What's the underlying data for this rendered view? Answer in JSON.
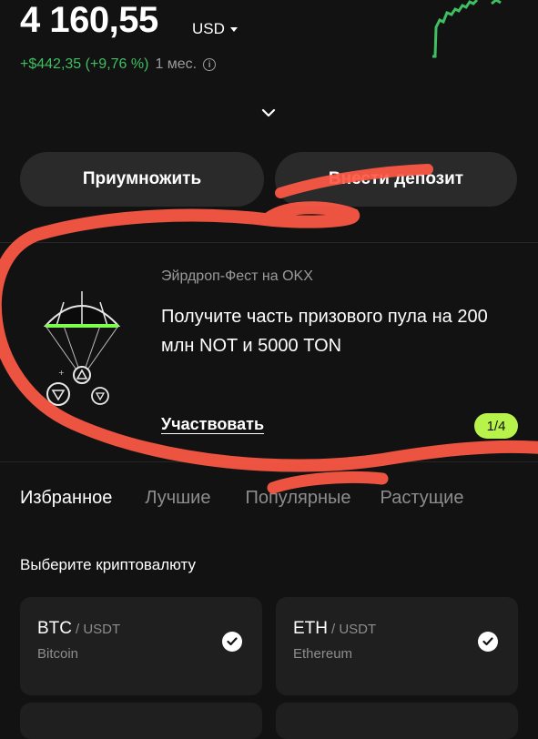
{
  "balance": {
    "amount": "4 160,55",
    "currency": "USD",
    "change": "+$442,35 (+9,76 %)",
    "period": "1 мес.",
    "info_icon": "info-icon",
    "accent_color": "#3fbf62"
  },
  "actions": {
    "multiply_label": "Приумножить",
    "deposit_label": "Внести депозит"
  },
  "promo": {
    "subtitle": "Эйрдроп-Фест на OKX",
    "title": "Получите часть призового пула на 200 млн NOT и 5000 TON",
    "cta": "Участвовать",
    "pager": "1/4",
    "pager_color": "#b7f34a"
  },
  "tabs": [
    "Избранное",
    "Лучшие",
    "Популярные",
    "Растущие"
  ],
  "section_title": "Выберите криптовалюту",
  "coins": [
    {
      "symbol": "BTC",
      "pair": "/ USDT",
      "name": "Bitcoin",
      "selected": true
    },
    {
      "symbol": "ETH",
      "pair": "/ USDT",
      "name": "Ethereum",
      "selected": true
    }
  ]
}
